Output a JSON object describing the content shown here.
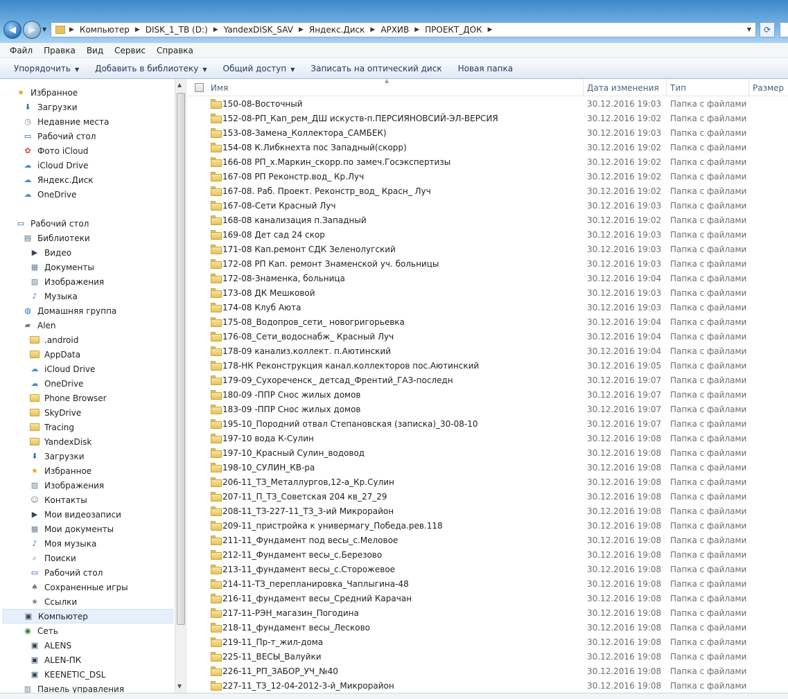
{
  "address": {
    "crumbs": [
      "Компьютер",
      "DISK_1_TB (D:)",
      "YandexDISK_SAV",
      "Яндекс.Диск",
      "АРХИВ",
      "ПРОЕКТ_ДОК"
    ]
  },
  "menu": [
    "Файл",
    "Правка",
    "Вид",
    "Сервис",
    "Справка"
  ],
  "toolbar": {
    "organize": "Упорядочить",
    "add_library": "Добавить в библиотеку",
    "share": "Общий доступ",
    "burn": "Записать на оптический диск",
    "new_folder": "Новая папка"
  },
  "nav": [
    {
      "label": "Избранное",
      "icon": "star-icon",
      "level": 0
    },
    {
      "label": "Загрузки",
      "icon": "downloads-icon",
      "level": 1
    },
    {
      "label": "Недавние места",
      "icon": "recent-places-icon",
      "level": 1
    },
    {
      "label": "Рабочий стол",
      "icon": "desktop-icon",
      "level": 1
    },
    {
      "label": "Фото iCloud",
      "icon": "photos-icon",
      "level": 1
    },
    {
      "label": "iCloud Drive",
      "icon": "cloud-icon",
      "level": 1
    },
    {
      "label": "Яндекс.Диск",
      "icon": "cloud-icon",
      "level": 1
    },
    {
      "label": "OneDrive",
      "icon": "cloud-icon",
      "level": 1
    },
    {
      "label": "",
      "icon": "",
      "level": -1
    },
    {
      "label": "Рабочий стол",
      "icon": "desktop-icon",
      "level": 0
    },
    {
      "label": "Библиотеки",
      "icon": "libraries-icon",
      "level": 1
    },
    {
      "label": "Видео",
      "icon": "video-icon",
      "level": 2
    },
    {
      "label": "Документы",
      "icon": "documents-icon",
      "level": 2
    },
    {
      "label": "Изображения",
      "icon": "pictures-icon",
      "level": 2
    },
    {
      "label": "Музыка",
      "icon": "music-icon",
      "level": 2
    },
    {
      "label": "Домашняя группа",
      "icon": "homegroup-icon",
      "level": 1
    },
    {
      "label": "Alen",
      "icon": "user-folder-icon",
      "level": 1
    },
    {
      "label": ".android",
      "icon": "folder-icon",
      "level": 2
    },
    {
      "label": "AppData",
      "icon": "folder-icon",
      "level": 2
    },
    {
      "label": "iCloud Drive",
      "icon": "cloud-icon",
      "level": 2
    },
    {
      "label": "OneDrive",
      "icon": "cloud-icon",
      "level": 2
    },
    {
      "label": "Phone Browser",
      "icon": "folder-icon",
      "level": 2
    },
    {
      "label": "SkyDrive",
      "icon": "folder-icon",
      "level": 2
    },
    {
      "label": "Tracing",
      "icon": "folder-icon",
      "level": 2
    },
    {
      "label": "YandexDisk",
      "icon": "folder-icon",
      "level": 2
    },
    {
      "label": "Загрузки",
      "icon": "downloads-icon",
      "level": 2
    },
    {
      "label": "Избранное",
      "icon": "star-icon",
      "level": 2
    },
    {
      "label": "Изображения",
      "icon": "pictures-icon",
      "level": 2
    },
    {
      "label": "Контакты",
      "icon": "contacts-icon",
      "level": 2
    },
    {
      "label": "Мои видеозаписи",
      "icon": "video-icon",
      "level": 2
    },
    {
      "label": "Мои документы",
      "icon": "documents-icon",
      "level": 2
    },
    {
      "label": "Моя музыка",
      "icon": "music-icon",
      "level": 2
    },
    {
      "label": "Поиски",
      "icon": "search-icon",
      "level": 2
    },
    {
      "label": "Рабочий стол",
      "icon": "desktop-icon",
      "level": 2
    },
    {
      "label": "Сохраненные игры",
      "icon": "games-icon",
      "level": 2
    },
    {
      "label": "Ссылки",
      "icon": "links-icon",
      "level": 2
    },
    {
      "label": "Компьютер",
      "icon": "computer-icon",
      "level": 1,
      "selected": true
    },
    {
      "label": "Сеть",
      "icon": "network-icon",
      "level": 1
    },
    {
      "label": "ALENS",
      "icon": "computer-icon",
      "level": 2
    },
    {
      "label": "ALEN-ПК",
      "icon": "computer-icon",
      "level": 2
    },
    {
      "label": "KEENETIC_DSL",
      "icon": "computer-icon",
      "level": 2
    },
    {
      "label": "Панель управления",
      "icon": "control-panel-icon",
      "level": 1
    }
  ],
  "columns": {
    "name": "Имя",
    "date": "Дата изменения",
    "type": "Тип",
    "size": "Размер"
  },
  "files": [
    {
      "name": "150-08-Восточный",
      "date": "30.12.2016 19:03",
      "type": "Папка с файлами"
    },
    {
      "name": "152-08-РП_Кап_рем_ДШ искуств-п.ПЕРСИЯНОВСИЙ-ЭЛ-ВЕРСИЯ",
      "date": "30.12.2016 19:02",
      "type": "Папка с файлами"
    },
    {
      "name": "153-08-Замена_Коллектора_САМБЕК)",
      "date": "30.12.2016 19:03",
      "type": "Папка с файлами"
    },
    {
      "name": "154-08 К.Либкнехта пос Западный(скорр)",
      "date": "30.12.2016 19:02",
      "type": "Папка с файлами"
    },
    {
      "name": "166-08 РП_х.Маркин_скорр.по замеч.Госэкспертизы",
      "date": "30.12.2016 19:02",
      "type": "Папка с файлами"
    },
    {
      "name": "167-08 РП Реконстр.вод_ Кр.Луч",
      "date": "30.12.2016 19:02",
      "type": "Папка с файлами"
    },
    {
      "name": "167-08. Раб. Проект. Реконстр_вод_ Красн_ Луч",
      "date": "30.12.2016 19:02",
      "type": "Папка с файлами"
    },
    {
      "name": "167-08-Сети Красный Луч",
      "date": "30.12.2016 19:03",
      "type": "Папка с файлами"
    },
    {
      "name": "168-08 канализация п.Западный",
      "date": "30.12.2016 19:02",
      "type": "Папка с файлами"
    },
    {
      "name": "169-08 Дет сад 24 скор",
      "date": "30.12.2016 19:03",
      "type": "Папка с файлами"
    },
    {
      "name": "171-08 Кап.ремонт СДК Зеленолугский",
      "date": "30.12.2016 19:03",
      "type": "Папка с файлами"
    },
    {
      "name": "172-08 РП  Кап. ремонт Знаменской уч. больницы",
      "date": "30.12.2016 19:03",
      "type": "Папка с файлами"
    },
    {
      "name": "172-08-Знаменка, больница",
      "date": "30.12.2016 19:04",
      "type": "Папка с файлами"
    },
    {
      "name": "173-08 ДК Мешковой",
      "date": "30.12.2016 19:03",
      "type": "Папка с файлами"
    },
    {
      "name": "174-08 Клуб Аюта",
      "date": "30.12.2016 19:03",
      "type": "Папка с файлами"
    },
    {
      "name": "175-08_Водопров_сети_ новогригорьевка",
      "date": "30.12.2016 19:04",
      "type": "Папка с файлами"
    },
    {
      "name": "176-08_Сети_водоснабж_ Красный Луч",
      "date": "30.12.2016 19:04",
      "type": "Папка с файлами"
    },
    {
      "name": "178-09 канализ.коллект.  п.Аютинский",
      "date": "30.12.2016 19:04",
      "type": "Папка с файлами"
    },
    {
      "name": "178-НК Реконструкция канал.коллекторов пос.Аютинский",
      "date": "30.12.2016 19:05",
      "type": "Папка с файлами"
    },
    {
      "name": "179-09_Сухореченск_ детсад_Френтий_ГАЗ-последн",
      "date": "30.12.2016 19:07",
      "type": "Папка с файлами"
    },
    {
      "name": "180-09 -ППР Снос жилых домов",
      "date": "30.12.2016 19:07",
      "type": "Папка с файлами"
    },
    {
      "name": "183-09 -ППР Снос жилых домов",
      "date": "30.12.2016 19:07",
      "type": "Папка с файлами"
    },
    {
      "name": "195-10_Породний отвал Степановская (записка)_30-08-10",
      "date": "30.12.2016 19:07",
      "type": "Папка с файлами"
    },
    {
      "name": "197-10 вода К-Сулин",
      "date": "30.12.2016 19:08",
      "type": "Папка с файлами"
    },
    {
      "name": "197-10_Красный Сулин_водовод",
      "date": "30.12.2016 19:08",
      "type": "Папка с файлами"
    },
    {
      "name": "198-10_СУЛИН_КВ-ра",
      "date": "30.12.2016 19:08",
      "type": "Папка с файлами"
    },
    {
      "name": "206-11_ТЗ_Металлургов,12-а_Кр.Сулин",
      "date": "30.12.2016 19:08",
      "type": "Папка с файлами"
    },
    {
      "name": "207-11_П_ТЗ_Советская 204 кв_27_29",
      "date": "30.12.2016 19:08",
      "type": "Папка с файлами"
    },
    {
      "name": "208-11_ТЗ-227-11_ТЗ_3-ий Микрорайон",
      "date": "30.12.2016 19:08",
      "type": "Папка с файлами"
    },
    {
      "name": "209-11_пристройка к универмагу_Победа.рев.118",
      "date": "30.12.2016 19:08",
      "type": "Папка с файлами"
    },
    {
      "name": "211-11_Фундамент под весы_с.Меловое",
      "date": "30.12.2016 19:08",
      "type": "Папка с файлами"
    },
    {
      "name": "212-11_Фундамент весы_с.Березово",
      "date": "30.12.2016 19:08",
      "type": "Папка с файлами"
    },
    {
      "name": "213-11_фундамент весы_с.Сторожевое",
      "date": "30.12.2016 19:08",
      "type": "Папка с файлами"
    },
    {
      "name": "214-11-ТЗ_перепланировка_Чаплыгина-48",
      "date": "30.12.2016 19:08",
      "type": "Папка с файлами"
    },
    {
      "name": "216-11_фундамент весы_Средний Карачан",
      "date": "30.12.2016 19:08",
      "type": "Папка с файлами"
    },
    {
      "name": "217-11-РЭН_магазин_Погодина",
      "date": "30.12.2016 19:08",
      "type": "Папка с файлами"
    },
    {
      "name": "218-11_фундамент весы_Лесково",
      "date": "30.12.2016 19:08",
      "type": "Папка с файлами"
    },
    {
      "name": "219-11_Пр-т_жил-дома",
      "date": "30.12.2016 19:08",
      "type": "Папка с файлами"
    },
    {
      "name": "225-11_ВЕСЫ_Валуйки",
      "date": "30.12.2016 19:08",
      "type": "Папка с файлами"
    },
    {
      "name": "226-11_РП_ЗАБОР_УЧ_№40",
      "date": "30.12.2016 19:08",
      "type": "Папка с файлами"
    },
    {
      "name": "227-11_ТЗ_12-04-2012-3-й_Микрорайон",
      "date": "30.12.2016 19:08",
      "type": "Папка с файлами"
    }
  ]
}
